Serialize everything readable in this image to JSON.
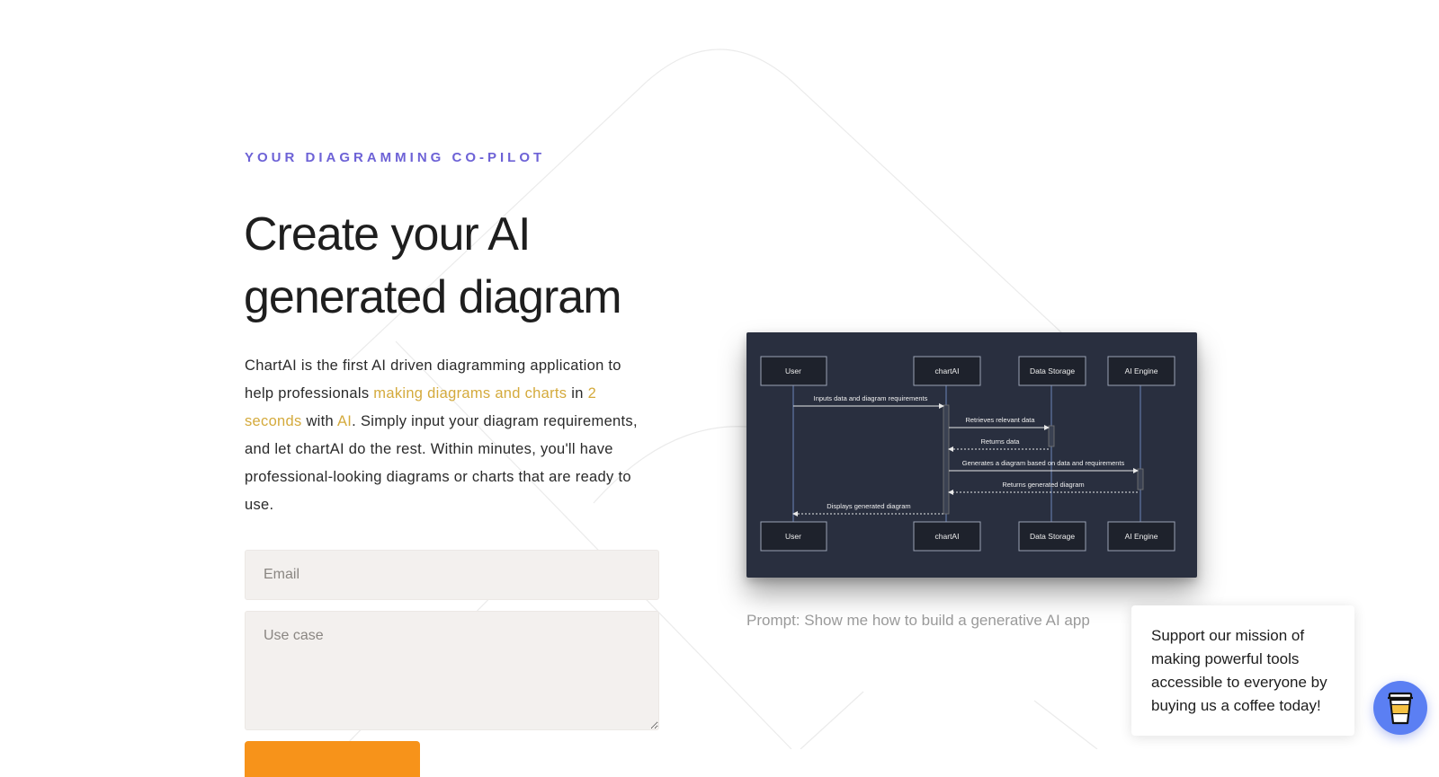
{
  "hero": {
    "eyebrow": "YOUR DIAGRAMMING CO-PILOT",
    "headline_line1": "Create your AI",
    "headline_line2": "generated diagram",
    "intro": {
      "p1": "ChartAI is the first AI driven diagramming application to help professionals ",
      "hl1": "making diagrams and charts",
      "p2": " in ",
      "hl2": "2 seconds",
      "p3": " with ",
      "hl3": "AI",
      "p4": ". Simply input your diagram requirements, and let chartAI do the rest. Within minutes, you'll have professional-looking diagrams or charts that are ready to use."
    }
  },
  "form": {
    "email_placeholder": "Email",
    "usecase_placeholder": "Use case",
    "submit_label": ""
  },
  "diagram": {
    "participants": [
      "User",
      "chartAI",
      "Data Storage",
      "AI Engine"
    ],
    "messages": [
      "Inputs data and diagram requirements",
      "Retrieves relevant data",
      "Returns data",
      "Generates a diagram based on data and requirements",
      "Returns generated diagram",
      "Displays generated diagram"
    ],
    "caption": "Prompt: Show me how to build a generative AI app"
  },
  "support": {
    "message": "Support our mission of making powerful tools accessible to everyone by buying us a coffee today!"
  },
  "colors": {
    "accent": "#6d62d6",
    "highlight": "#d4aa3c",
    "cta": "#f7931a",
    "diagram_bg": "#292f3f",
    "coffee_button": "#5b7ff3"
  },
  "icons": {
    "coffee_button": "coffee-cup-icon"
  }
}
